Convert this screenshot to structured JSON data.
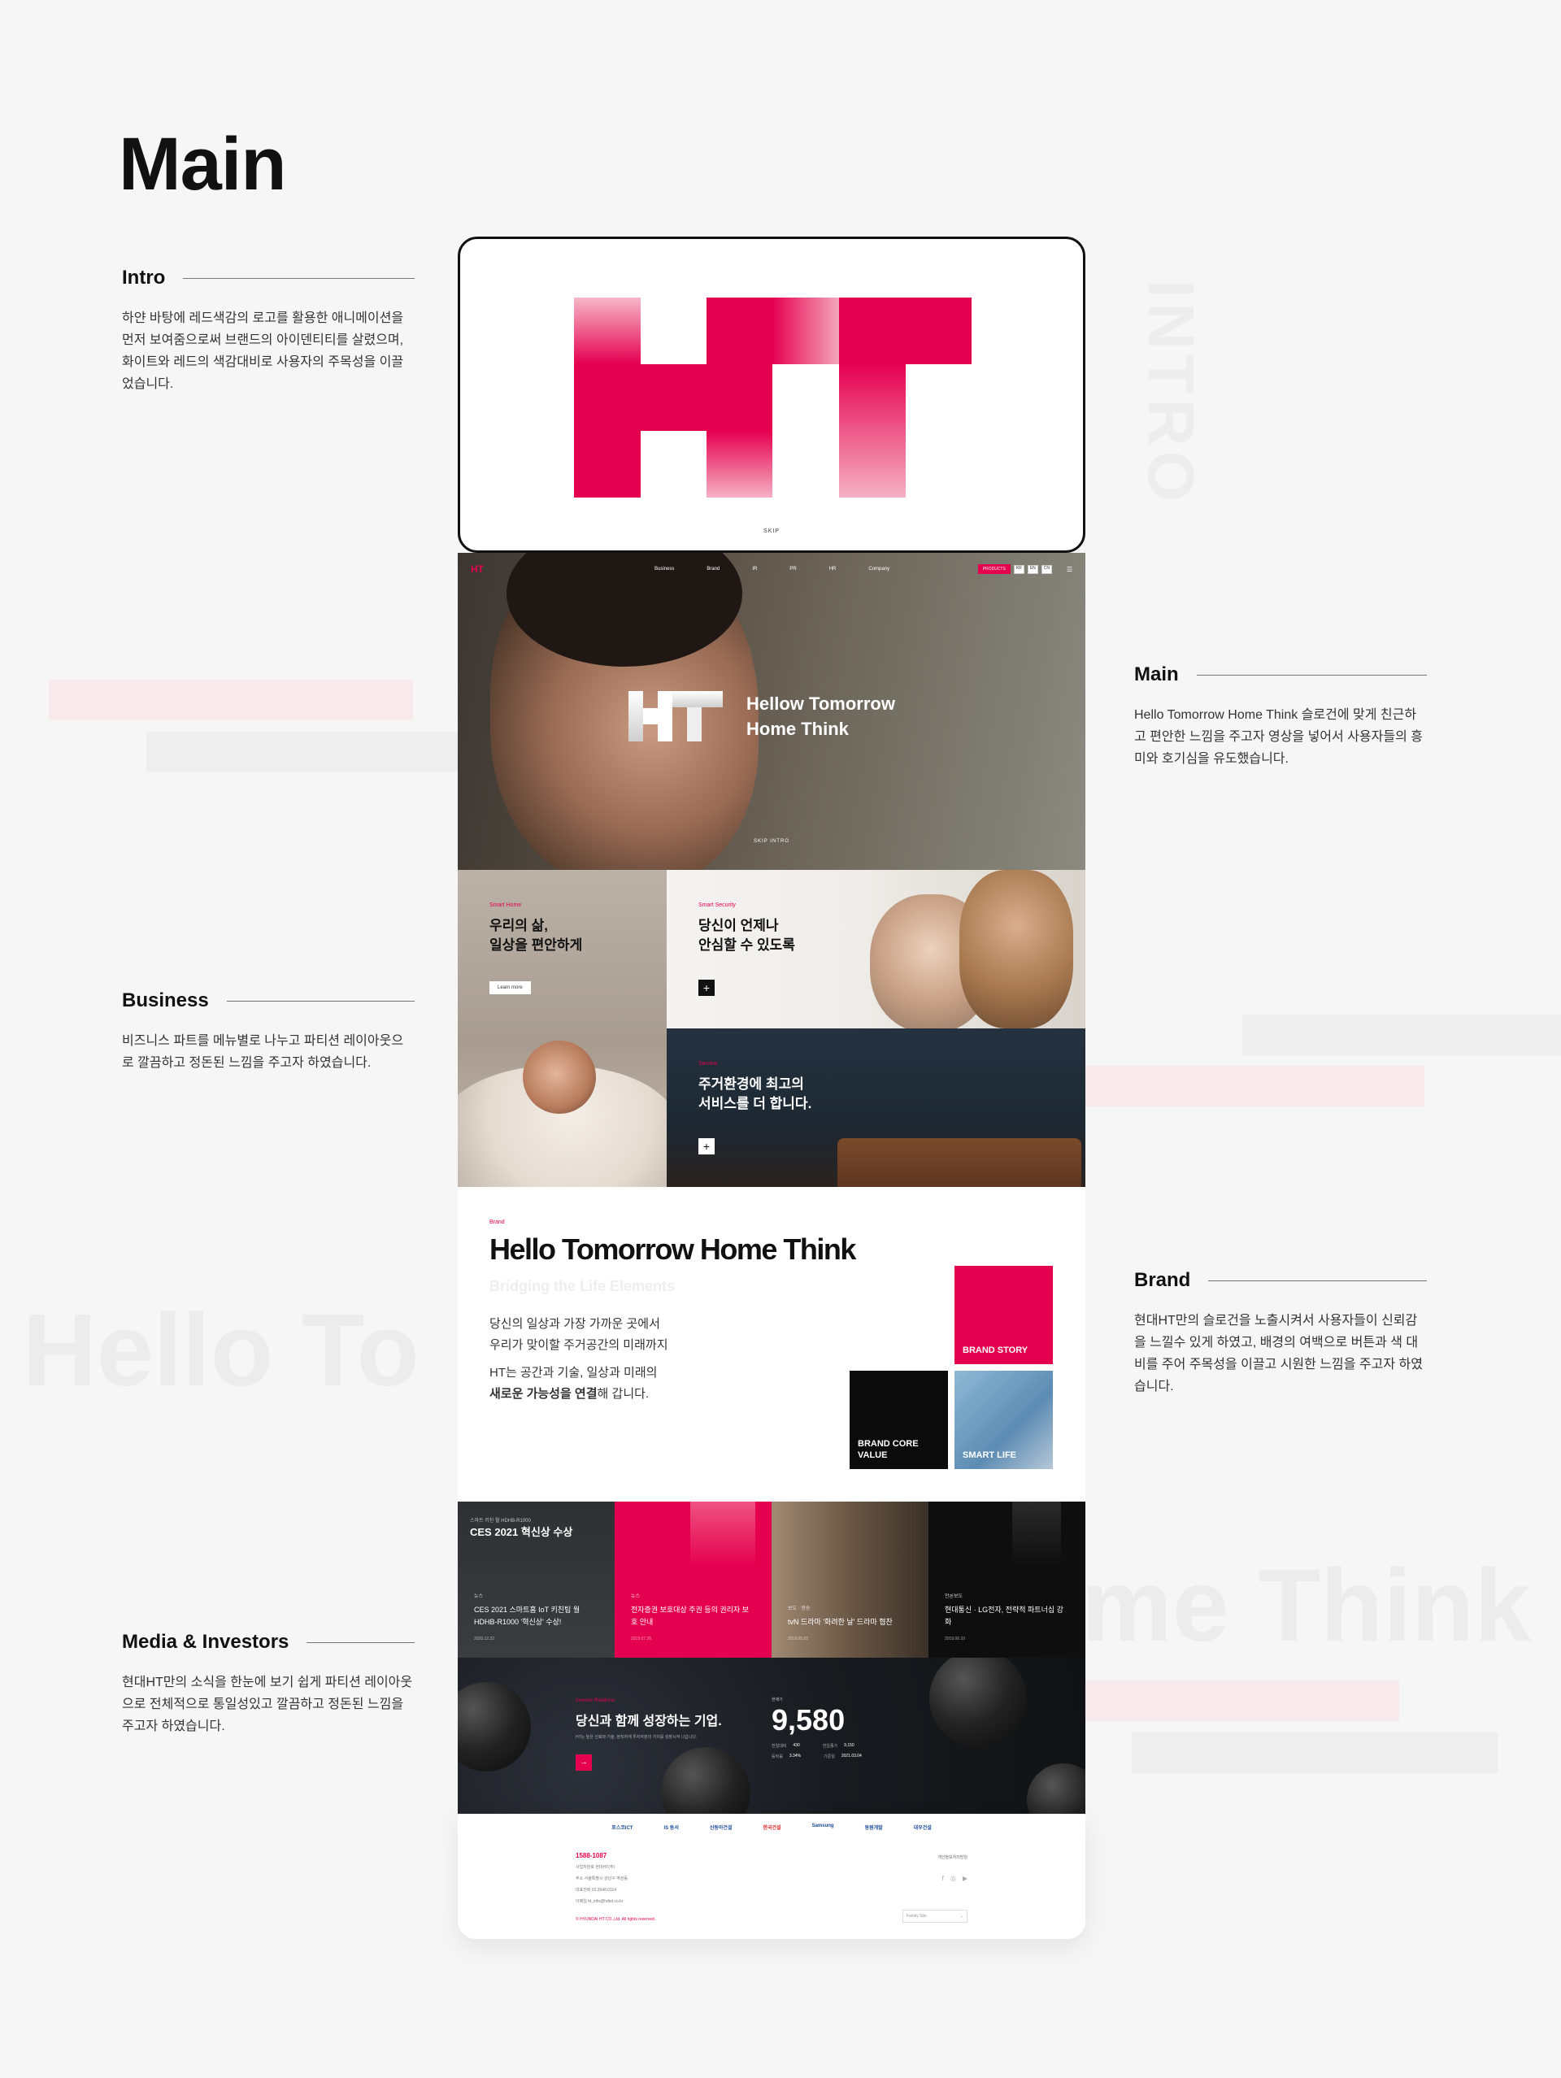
{
  "page": {
    "title": "Main"
  },
  "background_words": {
    "intro": "INTRO",
    "hello": "Hello To",
    "think": "me Think"
  },
  "notes": {
    "intro": {
      "title": "Intro",
      "text": "하얀 바탕에 레드색감의 로고를 활용한 애니메이션을 먼저 보여줌으로써 브랜드의 아이덴티티를 살렸으며, 화이트와 레드의 색감대비로 사용자의 주목성을 이끌었습니다."
    },
    "main": {
      "title": "Main",
      "text": "Hello Tomorrow Home Think 슬로건에 맞게 친근하고 편안한 느낌을 주고자 영상을 넣어서 사용자들의 흥미와 호기심을 유도했습니다."
    },
    "business": {
      "title": "Business",
      "text": "비즈니스 파트를 메뉴별로 나누고 파티션 레이아웃으로 깔끔하고 정돈된 느낌을 주고자 하였습니다."
    },
    "brand": {
      "title": "Brand",
      "text": "현대HT만의 슬로건을 노출시켜서 사용자들이 신뢰감을 느낄수 있게 하였고, 배경의 여백으로 버튼과 색 대비를 주어 주목성을 이끌고 시원한 느낌을 주고자 하였습니다."
    },
    "media": {
      "title": "Media & Investors",
      "text": "현대HT만의 소식을 한눈에 보기 쉽게 파티션 레이아웃으로 전체적으로 통일성있고 깔끔하고 정돈된 느낌을 주고자 하였습니다."
    }
  },
  "intro_screen": {
    "logo": "HT",
    "skip": "SKIP"
  },
  "gnb": {
    "logo": "HT",
    "menu": [
      "Business",
      "Brand",
      "IR",
      "PR",
      "HR",
      "Company"
    ],
    "products": "PRODUCTS",
    "langs": [
      "KR",
      "EN",
      "CN"
    ]
  },
  "hero": {
    "line1": "Hellow Tomorrow",
    "line2": "Home Think",
    "skip": "SKIP INTRO"
  },
  "business": {
    "home": {
      "tag": "Smart Home",
      "line1": "우리의 삶,",
      "line2": "일상을 편안하게",
      "btn": "Learn more"
    },
    "security": {
      "tag": "Smart Security",
      "line1": "당신이 언제나",
      "line2": "안심할 수 있도록"
    },
    "service": {
      "tag": "Service",
      "line1": "주거환경에 최고의",
      "line2": "서비스를 더 합니다."
    }
  },
  "brand": {
    "tag": "Brand",
    "title": "Hello Tomorrow Home Think",
    "subtitle": "Bridging the Life Elements",
    "p1a": "당신의 일상과 가장 가까운 곳에서",
    "p1b": "우리가 맞이할 주거공간의 미래까지",
    "p2a": "HT는 공간과 기술, 일상과 미래의",
    "p2b_strong": "새로운 가능성을 연결",
    "p2b_rest": "해 갑니다.",
    "tiles": {
      "story": "BRAND STORY",
      "value": "BRAND CORE VALUE",
      "smart": "SMART LIFE"
    }
  },
  "media": [
    {
      "badge_small": "스마트 키친 월 HDHB-R1000",
      "badge": "CES 2021 혁신상 수상",
      "cat": "뉴스",
      "title": "CES 2021 스마트홈 IoT 키친팁 월 HDHB-R1000 '혁신상' 수상!",
      "date": "2020.12.22"
    },
    {
      "cat": "뉴스",
      "title": "전자증권 보호대상 주권 등의 권리자 보호 안내",
      "date": "2019.07.26"
    },
    {
      "cat": "보도 · 방송",
      "title": "tvN 드라마 '화려한 날' 드라마 협찬",
      "date": "2019.05.02"
    },
    {
      "cat": "언론보도",
      "title": "현대통신 · LG전자, 전략적 파트너십 강화",
      "date": "2019.06.10"
    }
  ],
  "investors": {
    "tag": "Investor Relations",
    "headline": "당신과 함께 성장하는 기업.",
    "desc": "HT는 높은 신뢰와 기술, 정직하게 투자자분의 가치를 성장시켜 나갑니다.",
    "price_label": "현재가",
    "price": "9,580",
    "r1l": "전일대비",
    "r1v": "430",
    "r1l2": "전일종가",
    "r1v2": "9,150",
    "r2l": "등락률",
    "r2v": "3.34%",
    "r2l2": "기준일",
    "r2v2": "2021.03.04"
  },
  "footer": {
    "partners": [
      "포스코ICT",
      "IS 동서",
      "신동아건설",
      "한국건설",
      "Samsung",
      "동원개발",
      "대우건설"
    ],
    "tel": "1588-1087",
    "lines": [
      "사업자번호  현대HT(주)",
      "주소  서울특별시 강남구 역삼동",
      "대표전화  02.2648.0114",
      "이메일  ht_info@hdtel.co.kr"
    ],
    "copyright": "© HYUNDAI HT CO.,Ltd. All rights reserved.",
    "policy": "개인정보처리방침",
    "family": "Family Site"
  },
  "colors": {
    "brand_red": "#e5004f",
    "dark": "#111111"
  }
}
